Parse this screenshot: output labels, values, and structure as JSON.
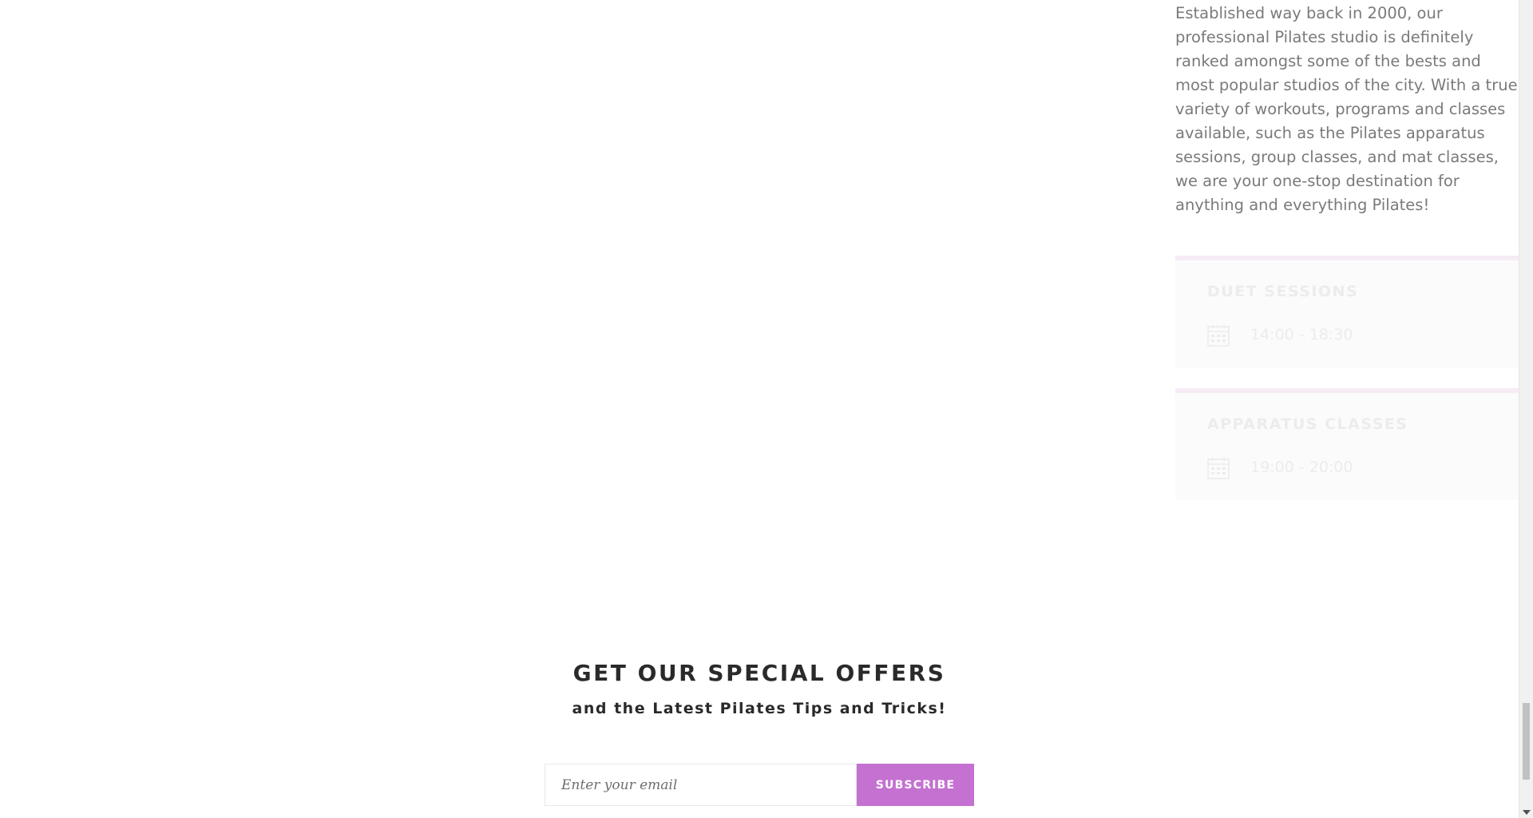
{
  "about": {
    "paragraph": "Established way back in 2000, our professional Pilates studio is definitely ranked amongst some of the bests and most popular studios of the city. With a true variety of workouts, programs and classes available, such as the Pilates apparatus sessions, group classes, and mat classes, we are your one-stop destination for anything and everything Pilates!"
  },
  "sessions": [
    {
      "title": "DUET SESSIONS",
      "time": "14:00 - 18:30",
      "icon": "calendar-icon"
    },
    {
      "title": "APPARATUS CLASSES",
      "time": "19:00 - 20:00",
      "icon": "calendar-icon"
    }
  ],
  "offers": {
    "title": "GET OUR SPECIAL OFFERS",
    "subtitle": "and the Latest Pilates Tips and Tricks!",
    "email_placeholder": "Enter your email",
    "email_value": "",
    "subscribe_label": "SUBSCRIBE"
  },
  "colors": {
    "accent": "#c471d1",
    "heading": "#2a2a2a",
    "body_text": "#7a7a7a",
    "card_border": "#f6ecf6"
  }
}
